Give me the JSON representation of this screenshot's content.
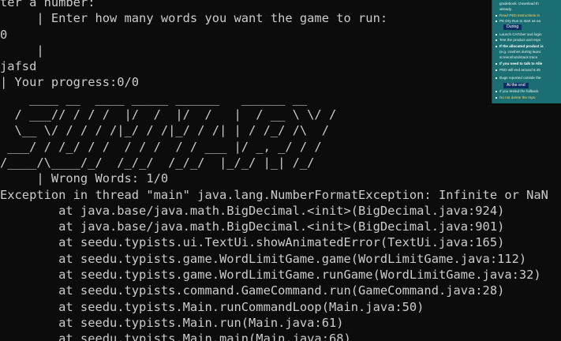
{
  "terminal": {
    "lines": [
      "ter a number:",
      "     | Enter how many words you want the game to run:",
      "0",
      "     |",
      "jafsd",
      "| Your progress:0/0",
      "    ____ __  ____ _____ ______   ______ __",
      "  / ___// / / /  |/  /  |/  /   |  / __ \\ \\/ /",
      "  \\__ \\/ / / / /|_/ / /|_/ / /| | / /_/ /\\  /",
      " ___/ / /_/ / /  / / /  / / ___ |/ _, _/ / /",
      "/____/\\____/_/  /_/_/  /_/_/  |_/_/ |_| /_/",
      "     | Wrong Words: 1/0",
      "Exception in thread \"main\" java.lang.NumberFormatException: Infinite or NaN",
      "        at java.base/java.math.BigDecimal.<init>(BigDecimal.java:924)",
      "        at java.base/java.math.BigDecimal.<init>(BigDecimal.java:901)",
      "        at seedu.typists.ui.TextUi.showAnimatedError(TextUi.java:165)",
      "        at seedu.typists.game.WordLimitGame.game(WordLimitGame.java:112)",
      "        at seedu.typists.game.WordLimitGame.runGame(WordLimitGame.java:32)",
      "        at seedu.typists.command.GameCommand.run(GameCommand.java:28)",
      "        at seedu.typists.Main.runCommandLoop(Main.java:50)",
      "        at seedu.typists.Main.run(Main.java:61)",
      "        at seedu.typists.Main.main(Main.java:68)"
    ]
  },
  "overlay": {
    "rows": [
      {
        "text": "gradebook. Download th",
        "style": "plain",
        "bullet": false
      },
      {
        "text": "already.",
        "style": "plain",
        "bullet": false
      },
      {
        "text": "Read PED instructions in",
        "style": "warn",
        "bullet": true
      },
      {
        "text": "PE Dry Run to start as ea",
        "style": "plain",
        "bullet": true
      },
      {
        "text": "Launch CATcher and login",
        "style": "plain",
        "bullet": true
      },
      {
        "text": "Test the product and repo",
        "style": "plain",
        "bullet": true
      },
      {
        "text": "If the allocated product is",
        "style": "bold",
        "bullet": true
      },
      {
        "text": "(e.g. crashes during launc",
        "style": "plain",
        "bullet": false
      },
      {
        "text": "screenshots/stack trace",
        "style": "plain",
        "bullet": false
      },
      {
        "text": "If you need to talk to Alle",
        "style": "bold",
        "bullet": true
      },
      {
        "text": "PED will end around 5:45",
        "style": "plain",
        "bullet": true
      },
      {
        "text": "Bugs reported outside the",
        "style": "plain",
        "bullet": true
      },
      {
        "text": "If you tested the fallback",
        "style": "plain",
        "bullet": true
      },
      {
        "text": "Do not delete the repo ",
        "style": "warn",
        "bullet": true
      }
    ],
    "headings": {
      "during": "During",
      "at_the_end": "At the end"
    }
  }
}
